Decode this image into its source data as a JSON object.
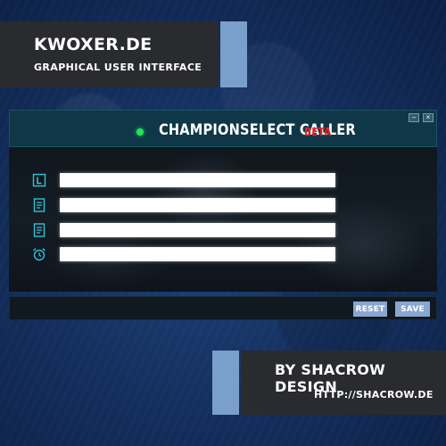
{
  "banner_top": {
    "title": "KWOXER.DE",
    "subtitle": "GRAPHICAL USER INTERFACE"
  },
  "banner_bottom": {
    "title": "BY SHACROW DESIGN",
    "subtitle": "HTTP://SHACROW.DE"
  },
  "window": {
    "title": "CHAMPIONSELECT CALLER",
    "beta_label": "BETA",
    "status_color": "#25e35a",
    "controls": {
      "minimize": "–",
      "close": "×"
    },
    "fields": [
      {
        "icon": "lane-l-icon",
        "value": "",
        "placeholder": ""
      },
      {
        "icon": "document-icon",
        "value": "",
        "placeholder": ""
      },
      {
        "icon": "document-icon",
        "value": "",
        "placeholder": ""
      },
      {
        "icon": "alarm-clock-icon",
        "value": "",
        "placeholder": ""
      }
    ],
    "buttons": {
      "reset": "RESET",
      "save": "SAVE"
    }
  },
  "colors": {
    "accent_blue": "#7b9fcb",
    "banner_dark": "#2a2b2f",
    "header_teal": "#0f3748",
    "icon_cyan": "#2fc3d8",
    "beta_red": "#e32a2a",
    "button_blue": "#88a6cf"
  }
}
